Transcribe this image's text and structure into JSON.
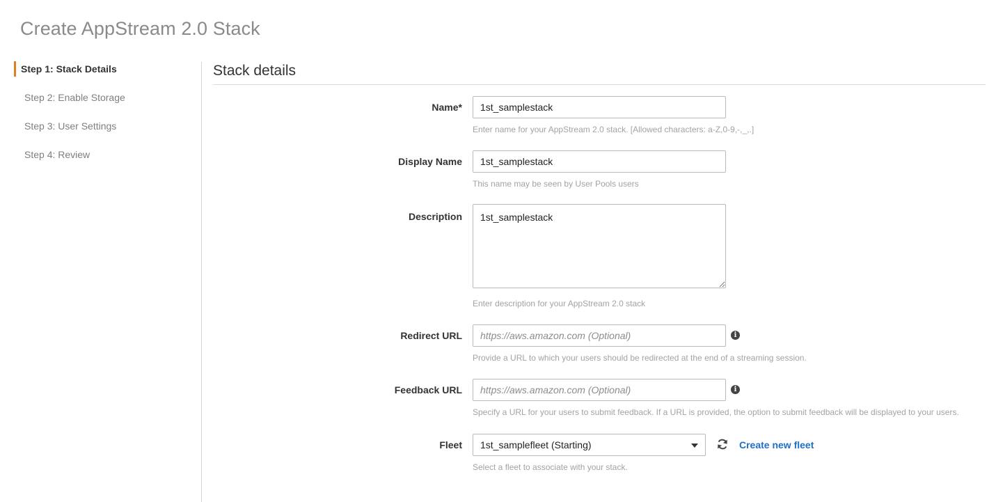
{
  "page": {
    "title": "Create AppStream 2.0 Stack"
  },
  "sidebar": {
    "steps": [
      {
        "label": "Step 1: Stack Details"
      },
      {
        "label": "Step 2: Enable Storage"
      },
      {
        "label": "Step 3: User Settings"
      },
      {
        "label": "Step 4: Review"
      }
    ]
  },
  "section": {
    "title": "Stack details"
  },
  "form": {
    "name": {
      "label": "Name*",
      "value": "1st_samplestack",
      "help": "Enter name for your AppStream 2.0 stack. [Allowed characters: a-Z,0-9,-,_,.]"
    },
    "display_name": {
      "label": "Display Name",
      "value": "1st_samplestack",
      "help": "This name may be seen by User Pools users"
    },
    "description": {
      "label": "Description",
      "value": "1st_samplestack",
      "help": "Enter description for your AppStream 2.0 stack"
    },
    "redirect_url": {
      "label": "Redirect URL",
      "placeholder": "https://aws.amazon.com (Optional)",
      "help": "Provide a URL to which your users should be redirected at the end of a streaming session."
    },
    "feedback_url": {
      "label": "Feedback URL",
      "placeholder": "https://aws.amazon.com (Optional)",
      "help": "Specify a URL for your users to submit feedback. If a URL is provided, the option to submit feedback will be displayed to your users."
    },
    "fleet": {
      "label": "Fleet",
      "selected": "1st_samplefleet (Starting)",
      "help": "Select a fleet to associate with your stack.",
      "create_link": "Create new fleet"
    }
  },
  "colors": {
    "accent": "#e07f1f",
    "link": "#1f6fc5"
  },
  "icons": {
    "info": "info-icon",
    "refresh": "refresh-icon",
    "dropdown": "chevron-down-icon"
  }
}
